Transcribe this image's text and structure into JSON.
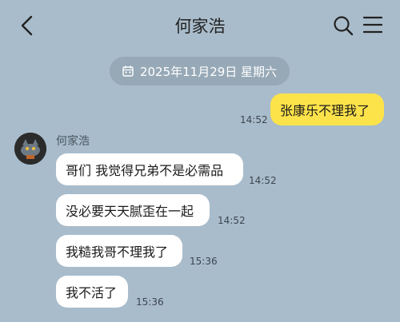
{
  "header": {
    "title": "何家浩",
    "back_icon": "chevron-left-icon",
    "search_icon": "search-icon",
    "menu_icon": "hamburger-menu-icon"
  },
  "date_divider": {
    "icon": "calendar-icon",
    "text": "2025年11月29日 星期六"
  },
  "messages": [
    {
      "side": "me",
      "text": "张康乐不理我了",
      "time": "14:52"
    },
    {
      "side": "other",
      "text": "哥们 我觉得兄弟不是必需品",
      "time": "14:52"
    },
    {
      "side": "other",
      "text": "没必要天天腻歪在一起",
      "time": "14:52"
    },
    {
      "side": "other",
      "text": "我糙我哥不理我了",
      "time": "15:36"
    },
    {
      "side": "other",
      "text": "我不活了",
      "time": "15:36"
    }
  ],
  "contact": {
    "name": "何家浩"
  },
  "colors": {
    "background": "#a9bccb",
    "my_bubble": "#fde34a",
    "other_bubble": "#ffffff",
    "date_pill": "#97a9b7"
  }
}
